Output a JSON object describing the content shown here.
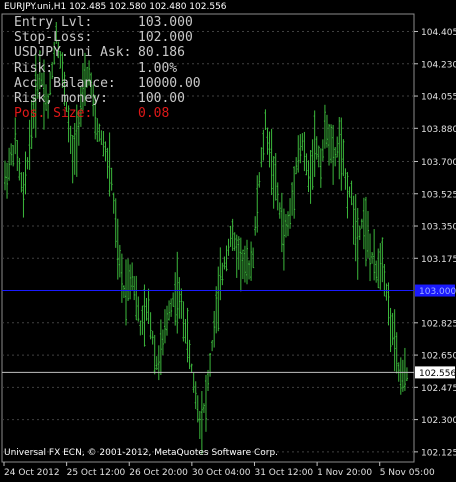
{
  "window": {
    "symbol_header": "EURJPY.uni,H1  102.485 102.580 102.480 102.556",
    "copyright": "Universal FX ECN, © 2001-2012, MetaQuotes Software Corp."
  },
  "overlay": {
    "rows": [
      {
        "label": "Entry Lvl:",
        "value": "103.000",
        "color": "#c8c8c8"
      },
      {
        "label": "Stop-Loss:",
        "value": "102.000",
        "color": "#c8c8c8"
      },
      {
        "label": "USDJPY.uni Ask:",
        "value": "80.186",
        "color": "#c8c8c8"
      },
      {
        "label": "Risk:",
        "value": "1.00%",
        "color": "#c8c8c8"
      },
      {
        "label": "Acc. Balance:",
        "value": "10000.00",
        "color": "#c8c8c8"
      },
      {
        "label": "Risk, money:",
        "value": "100.00",
        "color": "#c8c8c8"
      },
      {
        "label": "Pos. Size:",
        "value": "0.08",
        "color": "#e01818"
      }
    ]
  },
  "chart_data": {
    "type": "candlestick-bars",
    "price_ticks": [
      "104.405",
      "104.230",
      "104.055",
      "103.880",
      "103.700",
      "103.525",
      "103.350",
      "103.175",
      "102.825",
      "102.650",
      "102.475",
      "102.300",
      "102.125"
    ],
    "time_labels": [
      "24 Oct 2012",
      "25 Oct 12:00",
      "26 Oct 20:00",
      "30 Oct 04:00",
      "31 Oct 12:00",
      "1 Nov 20:00",
      "5 Nov 05:00"
    ],
    "ylim": [
      102.07,
      104.5
    ],
    "blue_line": {
      "price": 103.0,
      "label": "103.000"
    },
    "current_price": {
      "price": 102.556,
      "label": "102.556"
    },
    "bar_color": "#3cb83c",
    "grid": true,
    "key_points": [
      [
        0,
        103.6
      ],
      [
        5,
        103.8
      ],
      [
        9,
        103.5
      ],
      [
        13,
        103.9
      ],
      [
        17,
        104.2
      ],
      [
        21,
        104.0
      ],
      [
        25,
        104.4
      ],
      [
        29,
        104.1
      ],
      [
        33,
        103.7
      ],
      [
        37,
        104.0
      ],
      [
        41,
        104.2
      ],
      [
        44,
        103.9
      ],
      [
        48,
        103.8
      ],
      [
        52,
        103.6
      ],
      [
        55,
        103.2
      ],
      [
        58,
        103.0
      ],
      [
        62,
        103.1
      ],
      [
        66,
        102.8
      ],
      [
        70,
        102.9
      ],
      [
        74,
        102.6
      ],
      [
        77,
        102.7
      ],
      [
        80,
        102.9
      ],
      [
        84,
        103.0
      ],
      [
        88,
        102.8
      ],
      [
        92,
        102.5
      ],
      [
        95,
        102.3
      ],
      [
        98,
        102.4
      ],
      [
        102,
        102.8
      ],
      [
        106,
        103.1
      ],
      [
        110,
        103.3
      ],
      [
        114,
        103.2
      ],
      [
        118,
        103.1
      ],
      [
        121,
        103.2
      ],
      [
        124,
        103.6
      ],
      [
        127,
        103.9
      ],
      [
        130,
        103.7
      ],
      [
        133,
        103.5
      ],
      [
        136,
        103.3
      ],
      [
        139,
        103.4
      ],
      [
        142,
        103.7
      ],
      [
        145,
        103.8
      ],
      [
        148,
        103.6
      ],
      [
        151,
        103.8
      ],
      [
        154,
        103.7
      ],
      [
        157,
        103.9
      ],
      [
        160,
        103.7
      ],
      [
        163,
        103.8
      ],
      [
        166,
        103.6
      ],
      [
        169,
        103.5
      ],
      [
        172,
        103.3
      ],
      [
        175,
        103.4
      ],
      [
        178,
        103.2
      ],
      [
        181,
        103.1
      ],
      [
        184,
        103.2
      ],
      [
        187,
        102.9
      ],
      [
        190,
        102.7
      ],
      [
        193,
        102.5
      ],
      [
        196,
        102.55
      ]
    ]
  }
}
